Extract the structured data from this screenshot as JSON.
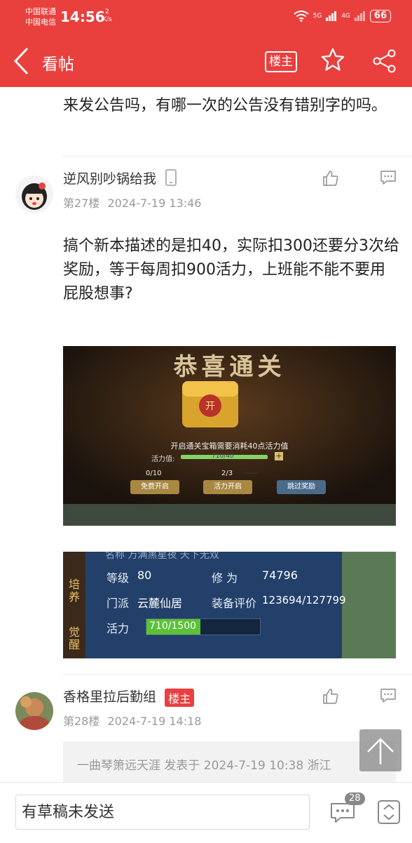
{
  "status_bar": {
    "carrier1": "中国联通",
    "carrier2": "中国电信",
    "time": "14:56",
    "speed_num": "2",
    "speed_unit": "K/s",
    "net1": "5G",
    "net2": "4G",
    "battery": "66"
  },
  "header": {
    "title": "看帖",
    "louzhu_label": "楼主"
  },
  "prev_post": {
    "text": "来发公告吗，有哪一次的公告没有错别字的吗。"
  },
  "post27": {
    "username": "逆风别吵锅给我",
    "floor": "第27楼",
    "datetime": "2024-7-19 13:46",
    "text": "搞个新本描述的是扣40，实际扣300还要分3次给奖励，等于每周扣900活力，上班能不能不要用屁股想事?",
    "image1": {
      "title": "恭喜通关",
      "chest_char": "开",
      "desc": "开启通关宝箱需要消耗40点活力值",
      "bar_label": "活力值:",
      "bar_value": "710/40",
      "count_free": "0/10",
      "count_vigor": "2/3",
      "btn_free": "免费开启",
      "btn_vigor": "活力开启",
      "btn_skip": "跳过奖励"
    },
    "image2": {
      "top_row": "名称  万满黑星夜 天下无双",
      "side1": "培养",
      "side2": "觉醒",
      "level_label": "等级",
      "level_value": "80",
      "cult_label": "修  为",
      "cult_value": "74796",
      "sect_label": "门派",
      "sect_value": "云麓仙居",
      "equip_label": "装备评价",
      "equip_value": "123694/127799",
      "vigor_label": "活力",
      "vigor_value": "710/1500",
      "vigor_fraction": 0.473
    }
  },
  "post28": {
    "username": "香格里拉后勤组",
    "badge": "楼主",
    "floor": "第28楼",
    "datetime": "2024-7-19 14:18",
    "quote": "一曲琴箫远天涯 发表于 2024-7-19 10:38 浙江"
  },
  "bottom_bar": {
    "draft_text": "有草稿未发送",
    "comment_count": "28"
  },
  "colors": {
    "brand": "#e9403e",
    "vigor_green": "#5bc236"
  }
}
